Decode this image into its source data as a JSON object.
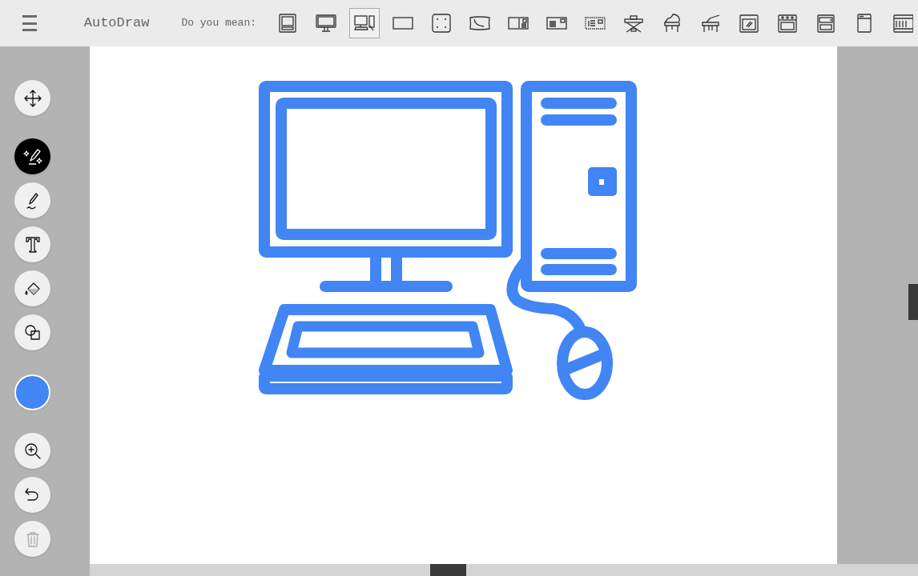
{
  "app": {
    "title": "AutoDraw"
  },
  "suggestions": {
    "label": "Do you mean:",
    "items": [
      {
        "kind": "retro-monitor",
        "selected": false
      },
      {
        "kind": "monitor",
        "selected": false
      },
      {
        "kind": "computer",
        "selected": true
      },
      {
        "kind": "rectangle",
        "selected": false
      },
      {
        "kind": "dotted-square",
        "selected": false
      },
      {
        "kind": "pillow",
        "selected": false
      },
      {
        "kind": "postcard",
        "selected": false
      },
      {
        "kind": "letter",
        "selected": false
      },
      {
        "kind": "stamp",
        "selected": false
      },
      {
        "kind": "keyboard-stand",
        "selected": false
      },
      {
        "kind": "grand-piano",
        "selected": false
      },
      {
        "kind": "open-piano",
        "selected": false
      },
      {
        "kind": "oven",
        "selected": false
      },
      {
        "kind": "stove",
        "selected": false
      },
      {
        "kind": "wall-oven",
        "selected": false
      },
      {
        "kind": "fridge",
        "selected": false
      },
      {
        "kind": "dishwasher",
        "selected": false
      }
    ]
  },
  "tools": [
    {
      "kind": "select",
      "selected": false
    },
    {
      "kind": "autodraw",
      "selected": true
    },
    {
      "kind": "draw",
      "selected": false
    },
    {
      "kind": "type",
      "selected": false
    },
    {
      "kind": "fill",
      "selected": false
    },
    {
      "kind": "shape",
      "selected": false
    }
  ],
  "color": "#4285f4",
  "actions": [
    {
      "kind": "zoom",
      "disabled": false
    },
    {
      "kind": "undo",
      "disabled": false
    },
    {
      "kind": "delete",
      "disabled": true
    }
  ]
}
